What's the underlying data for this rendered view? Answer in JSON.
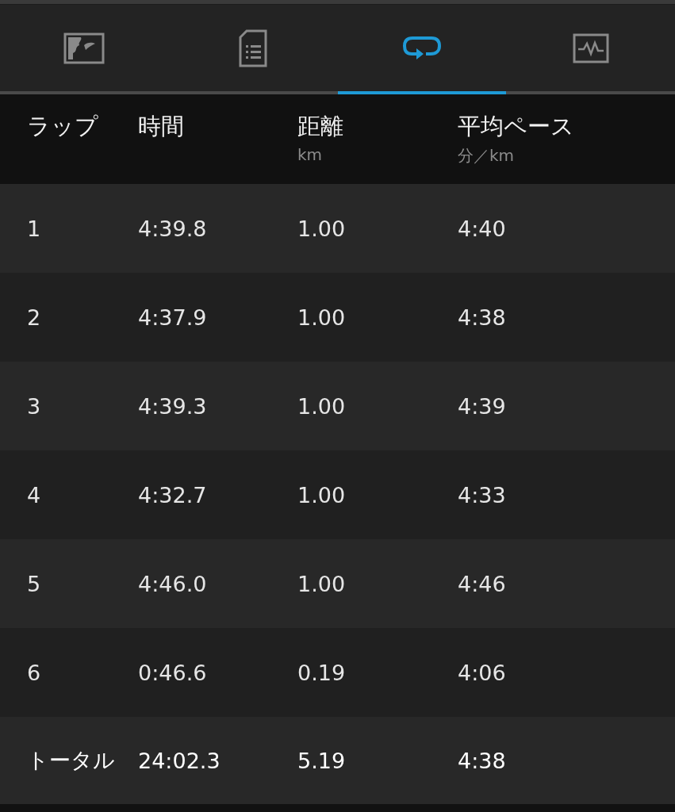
{
  "tabs": [
    {
      "kind": "map",
      "selected": false
    },
    {
      "kind": "document",
      "selected": false
    },
    {
      "kind": "laps",
      "selected": true
    },
    {
      "kind": "chart",
      "selected": false
    }
  ],
  "table": {
    "columns": [
      {
        "label": "ラップ"
      },
      {
        "label": "時間"
      },
      {
        "label": "距離",
        "unit": "km"
      },
      {
        "label": "平均ペース",
        "unit": "分／km"
      }
    ],
    "rows": [
      [
        "1",
        "4:39.8",
        "1.00",
        "4:40"
      ],
      [
        "2",
        "4:37.9",
        "1.00",
        "4:38"
      ],
      [
        "3",
        "4:39.3",
        "1.00",
        "4:39"
      ],
      [
        "4",
        "4:32.7",
        "1.00",
        "4:33"
      ],
      [
        "5",
        "4:46.0",
        "1.00",
        "4:46"
      ],
      [
        "6",
        "0:46.6",
        "0.19",
        "4:06"
      ]
    ],
    "total": [
      "トータル",
      "24:02.3",
      "5.19",
      "4:38"
    ]
  }
}
